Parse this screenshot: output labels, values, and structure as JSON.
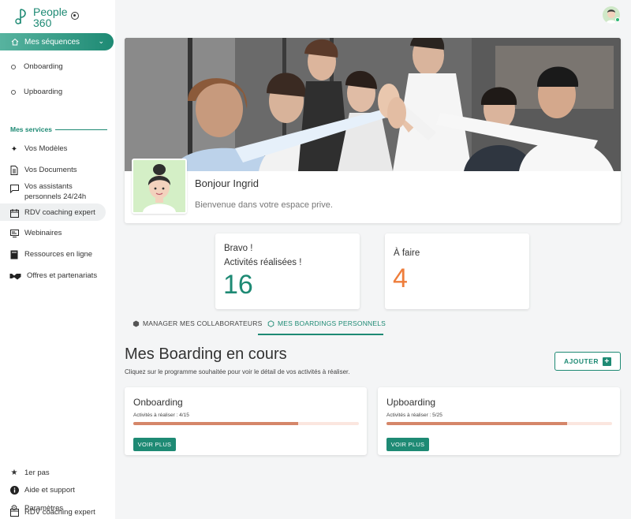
{
  "brand": {
    "line1": "People",
    "line2": "360"
  },
  "sidebar": {
    "active_item": "Mes séquences",
    "sub_items": [
      "Onboarding",
      "Upboarding"
    ],
    "section_label": "Mes services",
    "services": [
      {
        "label": "Vos Modèles",
        "icon": "sparkle-icon"
      },
      {
        "label": "Vos Documents",
        "icon": "document-icon"
      },
      {
        "label": "Vos assistants personnels 24/24h",
        "icon": "chat-icon"
      },
      {
        "label": "RDV coaching expert",
        "icon": "calendar-icon"
      },
      {
        "label": "Webinaires",
        "icon": "screen-icon"
      },
      {
        "label": "Ressources en ligne",
        "icon": "book-icon"
      },
      {
        "label": "Offres et partenariats",
        "icon": "handshake-icon"
      }
    ],
    "bottom": [
      {
        "label": "1er pas",
        "icon": "star-icon"
      },
      {
        "label": "Aide et support",
        "icon": "info-icon"
      },
      {
        "label": "Paramètres",
        "icon": "gear-icon"
      },
      {
        "label": "RDV coaching expert",
        "icon": "calendar-icon"
      }
    ]
  },
  "hero": {
    "greeting": "Bonjour Ingrid",
    "welcome": "Bienvenue dans votre espace prive."
  },
  "stats": {
    "done_line1": "Bravo !",
    "done_line2": "Activités réalisées !",
    "done_value": "16",
    "todo_label": "À faire",
    "todo_value": "4",
    "done_color": "#1e8a74",
    "todo_color": "#ee7d3b"
  },
  "tabs": [
    "MANAGER MES COLLABORATEURS",
    "MES BOARDINGS PERSONNELS"
  ],
  "boarding": {
    "title": "Mes Boarding en cours",
    "subtitle": "Cliquez sur le programme souhaitée pour voir le détail de vos activités à réaliser.",
    "add_label": "AJOUTER",
    "cards": [
      {
        "title": "Onboarding",
        "progress_text": "Activités à réaliser : 4/15",
        "progress": 0.73,
        "button": "VOIR PLUS"
      },
      {
        "title": "Upboarding",
        "progress_text": "Activités à réaliser : 5/25",
        "progress": 0.8,
        "button": "VOIR PLUS"
      }
    ]
  }
}
